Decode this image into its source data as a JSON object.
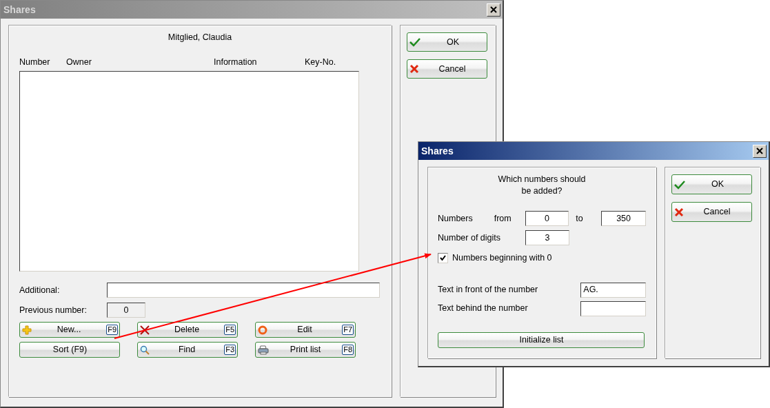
{
  "main_window": {
    "title": "Shares",
    "member": "Mitglied, Claudia",
    "columns": [
      "Number",
      "Owner",
      "Information",
      "Key-No."
    ],
    "fields": [
      {
        "label": "Additional:",
        "disabled": false
      },
      {
        "label": "Previous number:",
        "value": "0",
        "disabled": true
      }
    ],
    "buttons": [
      {
        "label": "New...",
        "key": "F9",
        "kind": "plus"
      },
      {
        "label": "Delete",
        "key": "F5",
        "kind": "cross"
      },
      {
        "label": "Edit",
        "key": "F7",
        "kind": "ring"
      },
      {
        "label": "Sort (F9)",
        "kind": "none"
      },
      {
        "label": "Find",
        "key": "F3",
        "kind": "magnifier"
      },
      {
        "label": "Print list",
        "key": "F8",
        "kind": "printer"
      }
    ],
    "side_buttons": [
      {
        "label": "OK",
        "kind": "ok"
      },
      {
        "label": "Cancel",
        "kind": "cancel"
      }
    ]
  },
  "dialog": {
    "title": "Shares",
    "question": "Which numbers should\nbe added?",
    "range": {
      "label": "Numbers",
      "from_label": "from",
      "from": "0",
      "to_label": "to",
      "to": "350"
    },
    "digits": {
      "label": "Number of digits",
      "value": "3"
    },
    "checkbox": {
      "label": "Numbers beginning with 0",
      "checked": true
    },
    "text_fields": [
      {
        "label": "Text in front of the number",
        "value": "AG."
      },
      {
        "label": "Text behind the number"
      }
    ],
    "init_button": "Initialize list",
    "side_buttons": [
      {
        "label": "OK",
        "kind": "ok"
      },
      {
        "label": "Cancel",
        "kind": "cancel"
      }
    ]
  }
}
